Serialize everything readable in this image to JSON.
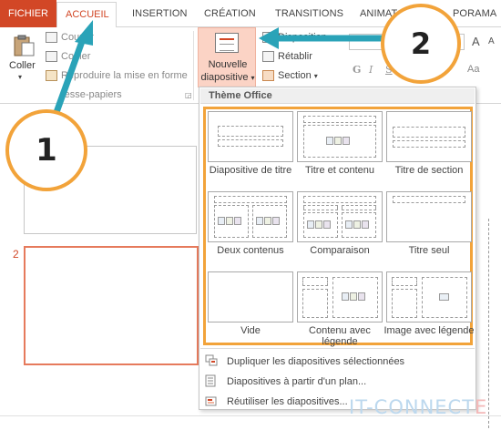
{
  "tabs": {
    "fichier": "FICHIER",
    "accueil": "ACCUEIL",
    "insertion": "INSERTION",
    "creation": "CRÉATION",
    "transitions": "TRANSITIONS",
    "animations": "ANIMAT",
    "diaporama": "PORAMA"
  },
  "ribbon": {
    "paste_label": "Coller",
    "cut_label": "Couper",
    "copy_label": "Copier",
    "format_painter_label": "Reproduire la mise en forme",
    "clipboard_group_label": "resse-papiers",
    "new_slide_line1": "Nouvelle",
    "new_slide_line2": "diapositive",
    "layout_label": "Disposition",
    "reset_label": "Rétablir",
    "section_label": "Section",
    "font_grow": "A",
    "font_shrink": "A",
    "clear_format": "Aa",
    "bold": "G",
    "italic": "I",
    "underline": "S"
  },
  "slides": {
    "second_slide_number": "2"
  },
  "dropdown": {
    "header": "Thème Office",
    "layouts": [
      {
        "label": "Diapositive de titre"
      },
      {
        "label": "Titre et contenu"
      },
      {
        "label": "Titre de section"
      },
      {
        "label": "Deux contenus"
      },
      {
        "label": "Comparaison"
      },
      {
        "label": "Titre seul"
      },
      {
        "label": "Vide"
      },
      {
        "label": "Contenu avec légende"
      },
      {
        "label": "Image avec légende"
      }
    ],
    "menu": [
      {
        "label": "Dupliquer les diapositives sélectionnées"
      },
      {
        "label": "Diapositives à partir d'un plan..."
      },
      {
        "label": "Réutiliser les diapositives..."
      }
    ]
  },
  "callouts": {
    "one": "1",
    "two": "2"
  },
  "watermark": {
    "main": "IT-CONNECT",
    "tail": "E"
  },
  "colors": {
    "accent": "#d24726",
    "new_slide_highlight": "#fbd3c5",
    "callout_ring": "#f2a33a",
    "arrow": "#2aa3b8"
  }
}
